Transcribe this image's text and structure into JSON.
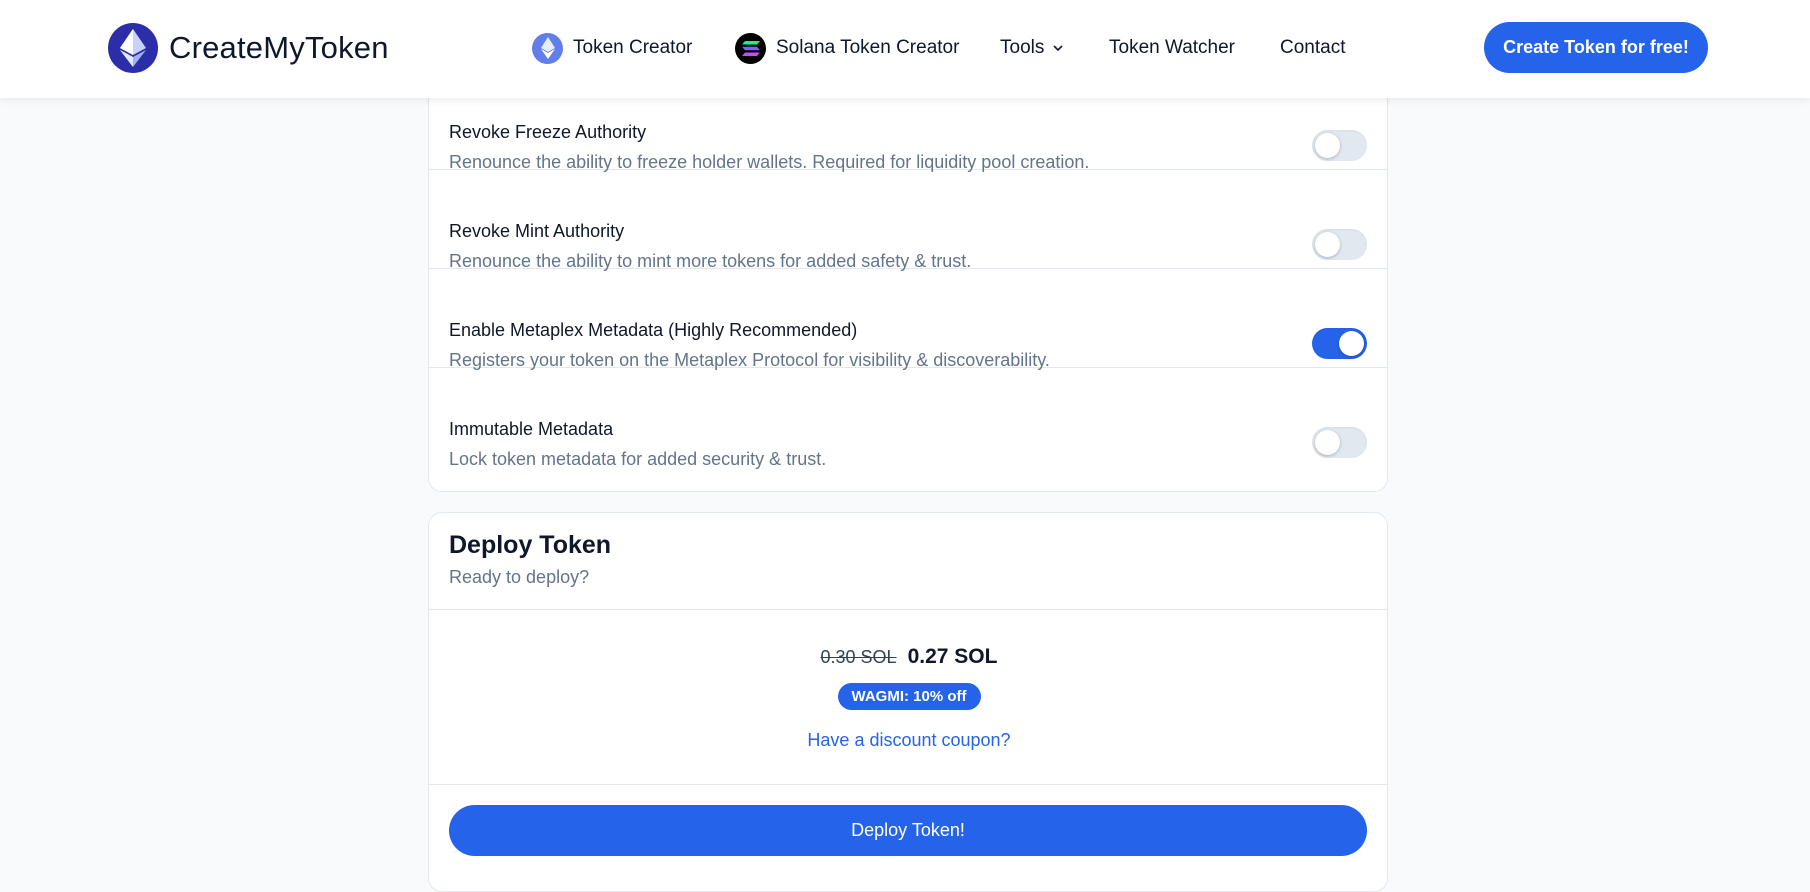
{
  "header": {
    "brand": "CreateMyToken",
    "nav": [
      {
        "label": "Token Creator",
        "icon": "ethereum-icon"
      },
      {
        "label": "Solana Token Creator",
        "icon": "solana-icon"
      },
      {
        "label": "Tools",
        "icon": "chevron-down-icon"
      },
      {
        "label": "Token Watcher"
      },
      {
        "label": "Contact"
      }
    ],
    "cta": "Create Token for free!"
  },
  "options": [
    {
      "title": "Revoke Freeze Authority",
      "desc": "Renounce the ability to freeze holder wallets. Required for liquidity pool creation.",
      "enabled": false
    },
    {
      "title": "Revoke Mint Authority",
      "desc": "Renounce the ability to mint more tokens for added safety & trust.",
      "enabled": false
    },
    {
      "title": "Enable Metaplex Metadata (Highly Recommended)",
      "desc": "Registers your token on the Metaplex Protocol for visibility & discoverability.",
      "enabled": true
    },
    {
      "title": "Immutable Metadata",
      "desc": "Lock token metadata for added security & trust.",
      "enabled": false
    }
  ],
  "deploy": {
    "title": "Deploy Token",
    "subtitle": "Ready to deploy?",
    "old_price": "0.30 SOL",
    "new_price": "0.27 SOL",
    "badge": "WAGMI: 10% off",
    "coupon_link": "Have a discount coupon?",
    "button": "Deploy Token!"
  },
  "colors": {
    "accent": "#2563eb",
    "muted_text": "#64748b",
    "border": "#e2e8f0",
    "page_bg": "#f8fafc"
  }
}
